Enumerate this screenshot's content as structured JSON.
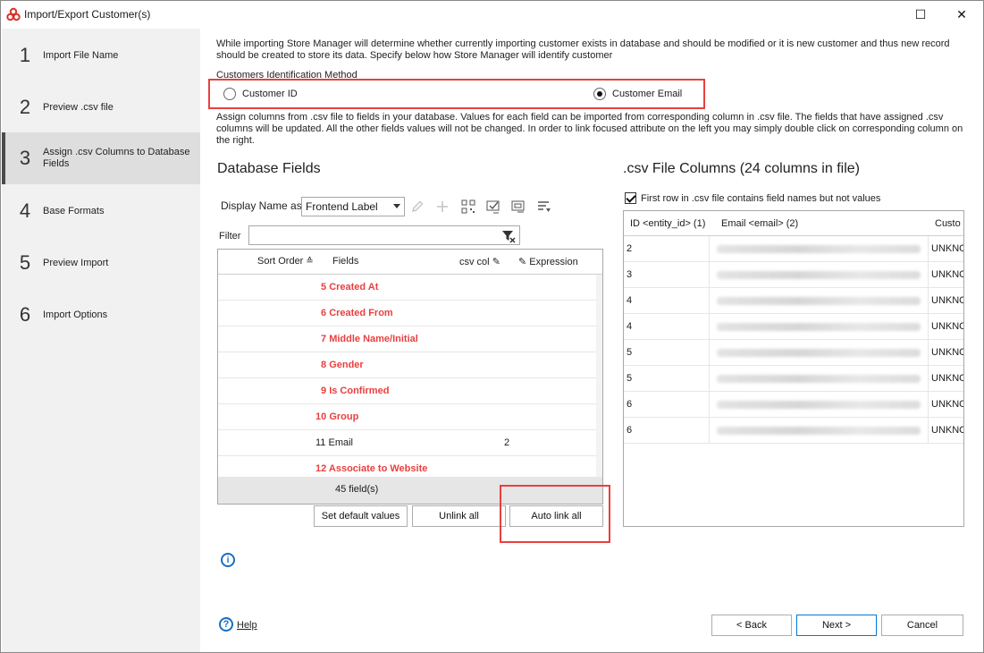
{
  "window": {
    "title": "Import/Export Customer(s)",
    "maximize_glyph": "☐",
    "close_glyph": "✕"
  },
  "steps": [
    {
      "num": "1",
      "label": "Import File Name"
    },
    {
      "num": "2",
      "label": "Preview .csv file"
    },
    {
      "num": "3",
      "label": "Assign .csv Columns to Database Fields",
      "active": true
    },
    {
      "num": "4",
      "label": "Base Formats"
    },
    {
      "num": "5",
      "label": "Preview Import"
    },
    {
      "num": "6",
      "label": "Import Options"
    }
  ],
  "intro": {
    "text": "While importing Store Manager will determine whether currently importing customer exists in database and should be modified or it is new customer and thus new record should be created to store its data. Specify below how Store Manager will identify customer"
  },
  "identification": {
    "label": "Customers Identification Method",
    "option_id": "Customer  ID",
    "option_email": "Customer Email",
    "selected": "email"
  },
  "assign_text": "Assign columns from .csv file to fields in your database. Values for each field can be imported from corresponding column in .csv file. The fields that have assigned .csv columns will be updated. All the other fields values will not be changed. In order to link focused attribute on the left you may simply double click on corresponding column on the right.",
  "db_fields": {
    "heading": "Database Fields",
    "display_name_label": "Display Name as",
    "display_name_value": "Frontend Label",
    "filter_label": "Filter",
    "columns": {
      "sort_order": "Sort Order",
      "fields": "Fields",
      "csv_col": "csv col",
      "expression": "Expression"
    },
    "rows": [
      {
        "num": "5",
        "name": "Created At",
        "csv": "",
        "unassigned": true
      },
      {
        "num": "6",
        "name": "Created From",
        "csv": "",
        "unassigned": true
      },
      {
        "num": "7",
        "name": "Middle Name/Initial",
        "csv": "",
        "unassigned": true
      },
      {
        "num": "8",
        "name": "Gender",
        "csv": "",
        "unassigned": true
      },
      {
        "num": "9",
        "name": "Is Confirmed",
        "csv": "",
        "unassigned": true
      },
      {
        "num": "10",
        "name": "Group",
        "csv": "",
        "unassigned": true
      },
      {
        "num": "11",
        "name": "Email",
        "csv": "2",
        "unassigned": false
      },
      {
        "num": "12",
        "name": "Associate to Website",
        "csv": "",
        "unassigned": true
      }
    ],
    "footer_count": "45 field(s)",
    "buttons": {
      "set_default": "Set default values",
      "unlink_all": "Unlink all",
      "auto_link_all": "Auto link all"
    }
  },
  "csv_columns": {
    "heading": ".csv File Columns (24 columns in file)",
    "first_row_label": "First row in .csv file contains field names but not values",
    "first_row_checked": true,
    "columns": {
      "col1": "ID <entity_id> (1)",
      "col2": "Email <email> (2)",
      "col3": "Custo"
    },
    "rows": [
      {
        "id": "2",
        "status": "UNKNO"
      },
      {
        "id": "3",
        "status": "UNKNO"
      },
      {
        "id": "4",
        "status": "UNKNO"
      },
      {
        "id": "4",
        "status": "UNKNO"
      },
      {
        "id": "5",
        "status": "UNKNO"
      },
      {
        "id": "5",
        "status": "UNKNO"
      },
      {
        "id": "6",
        "status": "UNKNO"
      },
      {
        "id": "6",
        "status": "UNKNO"
      }
    ]
  },
  "footer": {
    "info_glyph": "i",
    "help_glyph": "?",
    "help_label": "Help",
    "back": "< Back",
    "next": "Next >",
    "cancel": "Cancel"
  },
  "colors": {
    "highlight": "#e8403f",
    "unassigned_field": "#e8403f",
    "accent": "#0078d7"
  }
}
